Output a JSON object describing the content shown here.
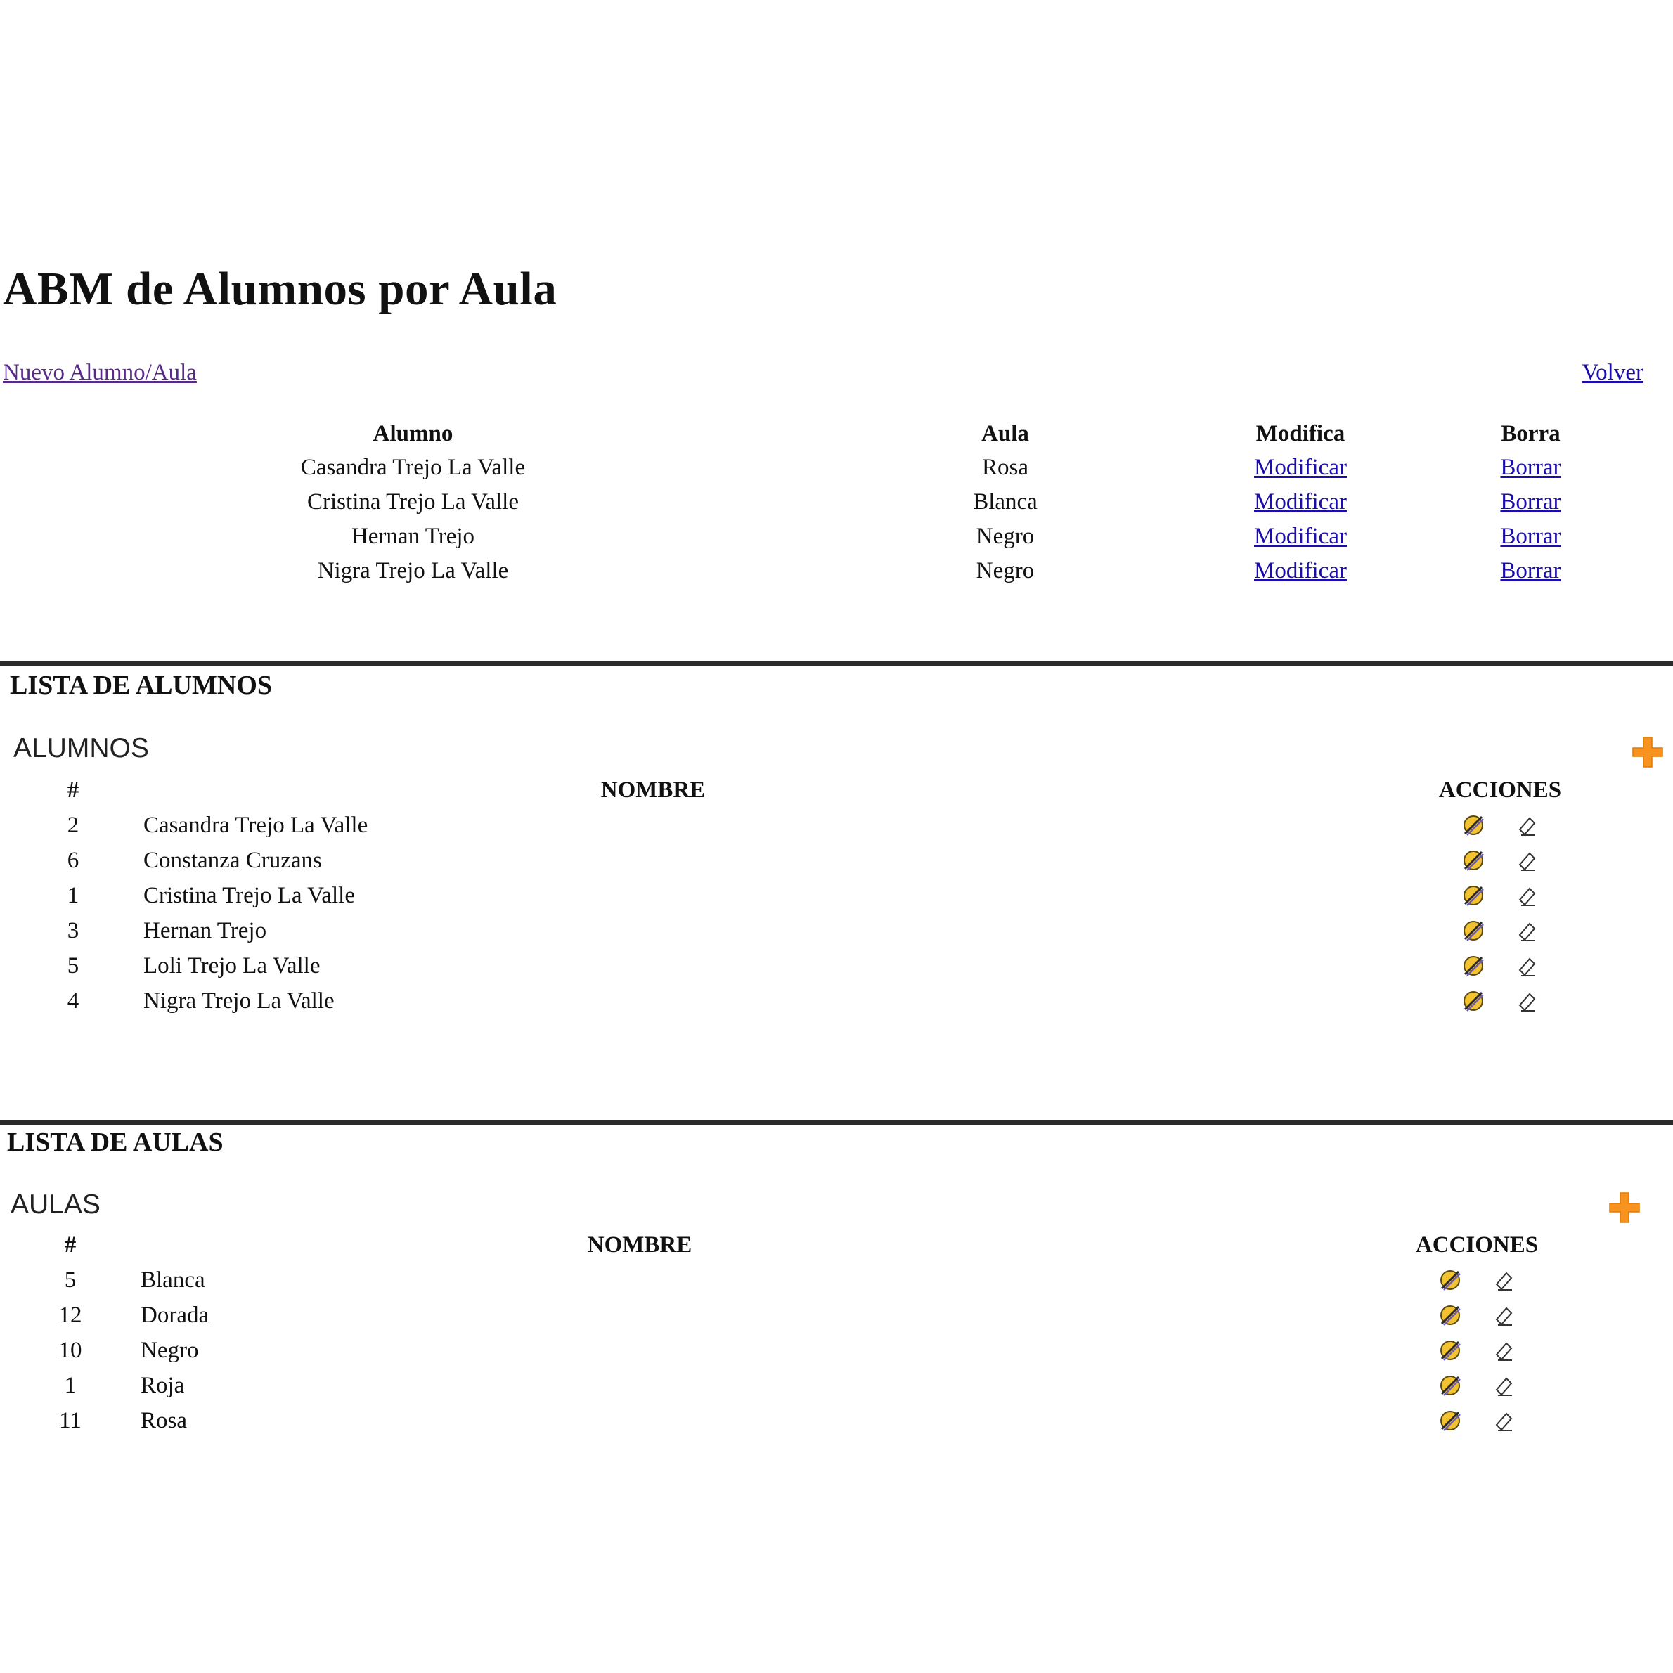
{
  "page": {
    "title": "ABM de Alumnos por Aula",
    "new_link": "Nuevo Alumno/Aula",
    "back_link": "Volver"
  },
  "assignments": {
    "headers": {
      "alumno": "Alumno",
      "aula": "Aula",
      "modifica": "Modifica",
      "borra": "Borra"
    },
    "rows": [
      {
        "alumno": "Casandra Trejo La Valle",
        "aula": "Rosa",
        "modify": "Modificar",
        "delete": "Borrar"
      },
      {
        "alumno": "Cristina Trejo La Valle",
        "aula": "Blanca",
        "modify": "Modificar",
        "delete": "Borrar"
      },
      {
        "alumno": "Hernan Trejo",
        "aula": "Negro",
        "modify": "Modificar",
        "delete": "Borrar"
      },
      {
        "alumno": "Nigra Trejo La Valle",
        "aula": "Negro",
        "modify": "Modificar",
        "delete": "Borrar"
      }
    ]
  },
  "students": {
    "section_title": "LISTA DE ALUMNOS",
    "panel_title": "ALUMNOS",
    "add_icon": "plus-icon",
    "headers": {
      "index": "#",
      "name": "NOMBRE",
      "actions": "ACCIONES"
    },
    "rows": [
      {
        "id": "2",
        "name": "Casandra Trejo La Valle"
      },
      {
        "id": "6",
        "name": "Constanza Cruzans"
      },
      {
        "id": "1",
        "name": "Cristina Trejo La Valle"
      },
      {
        "id": "3",
        "name": "Hernan Trejo"
      },
      {
        "id": "5",
        "name": "Loli Trejo La Valle"
      },
      {
        "id": "4",
        "name": "Nigra Trejo La Valle"
      }
    ]
  },
  "classrooms": {
    "section_title": "LISTA DE AULAS",
    "panel_title": "AULAS",
    "add_icon": "plus-icon",
    "headers": {
      "index": "#",
      "name": "NOMBRE",
      "actions": "ACCIONES"
    },
    "rows": [
      {
        "id": "5",
        "name": "Blanca"
      },
      {
        "id": "12",
        "name": "Dorada"
      },
      {
        "id": "10",
        "name": "Negro"
      },
      {
        "id": "1",
        "name": "Roja"
      },
      {
        "id": "11",
        "name": "Rosa"
      }
    ]
  },
  "icons": {
    "edit": "edit-pencil-icon",
    "delete": "eraser-icon"
  },
  "colors": {
    "accent_orange": "#f7931e",
    "link_blue": "#1a0dab",
    "link_visited": "#5a2a8a",
    "divider": "#2b2b2b"
  }
}
